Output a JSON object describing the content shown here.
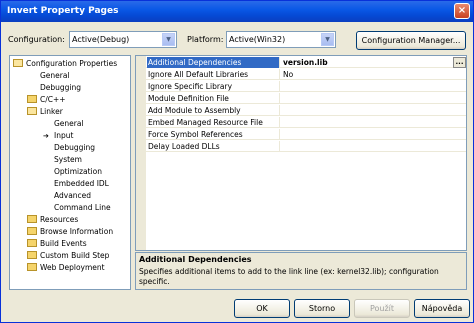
{
  "window": {
    "title": "Invert Property Pages",
    "close_glyph": "×"
  },
  "toolbar": {
    "configuration_label": "Configuration:",
    "configuration_value": "Active(Debug)",
    "platform_label": "Platform:",
    "platform_value": "Active(Win32)",
    "config_manager_label": "Configuration Manager..."
  },
  "tree": {
    "items": [
      {
        "label": "Configuration Properties",
        "icon": "folder-open-icon"
      },
      {
        "label": "General"
      },
      {
        "label": "Debugging"
      },
      {
        "label": "C/C++",
        "icon": "folder-icon"
      },
      {
        "label": "Linker",
        "icon": "folder-open-icon"
      },
      {
        "label": "General"
      },
      {
        "label": "Input",
        "icon": "pointer-arrow-icon"
      },
      {
        "label": "Debugging"
      },
      {
        "label": "System"
      },
      {
        "label": "Optimization"
      },
      {
        "label": "Embedded IDL"
      },
      {
        "label": "Advanced"
      },
      {
        "label": "Command Line"
      },
      {
        "label": "Resources",
        "icon": "folder-icon"
      },
      {
        "label": "Browse Information",
        "icon": "folder-icon"
      },
      {
        "label": "Build Events",
        "icon": "folder-icon"
      },
      {
        "label": "Custom Build Step",
        "icon": "folder-icon"
      },
      {
        "label": "Web Deployment",
        "icon": "folder-icon"
      }
    ]
  },
  "properties": {
    "rows": [
      {
        "name": "Additional Dependencies",
        "value": "version.lib",
        "ellipsis": "..."
      },
      {
        "name": "Ignore All Default Libraries",
        "value": "No"
      },
      {
        "name": "Ignore Specific Library",
        "value": ""
      },
      {
        "name": "Module Definition File",
        "value": ""
      },
      {
        "name": "Add Module to Assembly",
        "value": ""
      },
      {
        "name": "Embed Managed Resource File",
        "value": ""
      },
      {
        "name": "Force Symbol References",
        "value": ""
      },
      {
        "name": "Delay Loaded DLLs",
        "value": ""
      }
    ]
  },
  "description": {
    "title": "Additional Dependencies",
    "body": "Specifies additional items to add to the link line (ex: kernel32.lib); configuration specific."
  },
  "buttons": {
    "ok": "OK",
    "cancel": "Storno",
    "apply": "Použít",
    "help": "Nápověda"
  },
  "colors": {
    "titlebar": "#0a58e6",
    "selection": "#316ac5",
    "dialog_bg": "#ece9d8"
  }
}
